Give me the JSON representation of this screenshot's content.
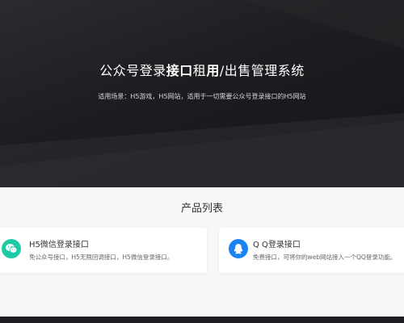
{
  "hero": {
    "title_part1": "公众号登录",
    "title_bold1": "接口",
    "title_part2": "租",
    "title_bold2": "用",
    "title_part3": "/出售管理系统",
    "subtitle": "适用场景：H5游戏，H5网站，适用于一切需要公众号登录接口的H5网站"
  },
  "products": {
    "title": "产品列表",
    "items": [
      {
        "icon": "wechat-icon",
        "color": "#1fc9a3",
        "title": "H5微信登录接口",
        "desc": "免公众号接口，H5无限回调接口，H5微信登录接口。"
      },
      {
        "icon": "qq-icon",
        "color": "#1a85f2",
        "title": "Q Q登录接口",
        "desc": "免费接口，可将你的web网站接入一个QQ登录功能。"
      }
    ]
  }
}
